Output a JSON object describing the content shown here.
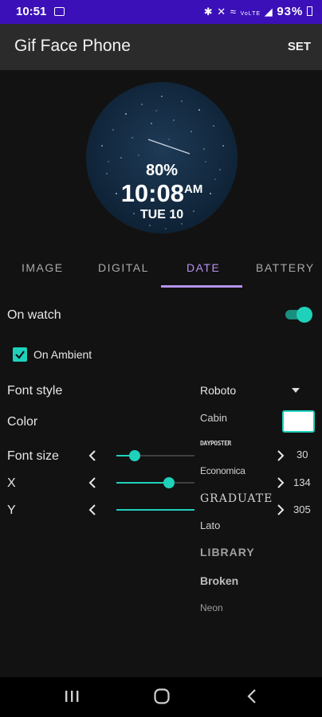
{
  "status_bar": {
    "time": "10:51",
    "icons": [
      "gallery-icon",
      "bluetooth-icon",
      "mute-icon",
      "wifi-icon",
      "volte-icon",
      "signal-icon"
    ],
    "volte": "VoLTE",
    "battery_percent": "93%"
  },
  "app_bar": {
    "title": "Gif Face Phone",
    "action": "SET"
  },
  "preview": {
    "battery": "80%",
    "time": "10:08",
    "ampm": "AM",
    "date": "TUE 10"
  },
  "tabs": [
    {
      "label": "IMAGE"
    },
    {
      "label": "DIGITAL"
    },
    {
      "label": "DATE",
      "active": true
    },
    {
      "label": "BATTERY"
    }
  ],
  "settings": {
    "on_watch": {
      "label": "On watch",
      "enabled": true
    },
    "on_ambient": {
      "label": "On Ambient",
      "checked": true
    },
    "font_style": {
      "label": "Font style",
      "selected": "Roboto"
    },
    "color": {
      "label": "Color",
      "value": "#ffffff"
    },
    "font_size": {
      "label": "Font size",
      "value": "30",
      "fraction": 0.23
    },
    "x": {
      "label": "X",
      "value": "134",
      "fraction": 0.67
    },
    "y": {
      "label": "Y",
      "value": "305",
      "fraction": 1.0
    }
  },
  "font_options": [
    "Cabin",
    "DAYPOSTER",
    "Economica",
    "GRADUATE",
    "Lato",
    "LIBRARY",
    "Broken",
    "Neon"
  ],
  "colors": {
    "accent": "#1fd1bb",
    "tab_active": "#b592f2",
    "status_bar": "#3b10b8"
  },
  "nav_bar": {
    "icons": [
      "recents-icon",
      "home-icon",
      "back-icon"
    ]
  }
}
